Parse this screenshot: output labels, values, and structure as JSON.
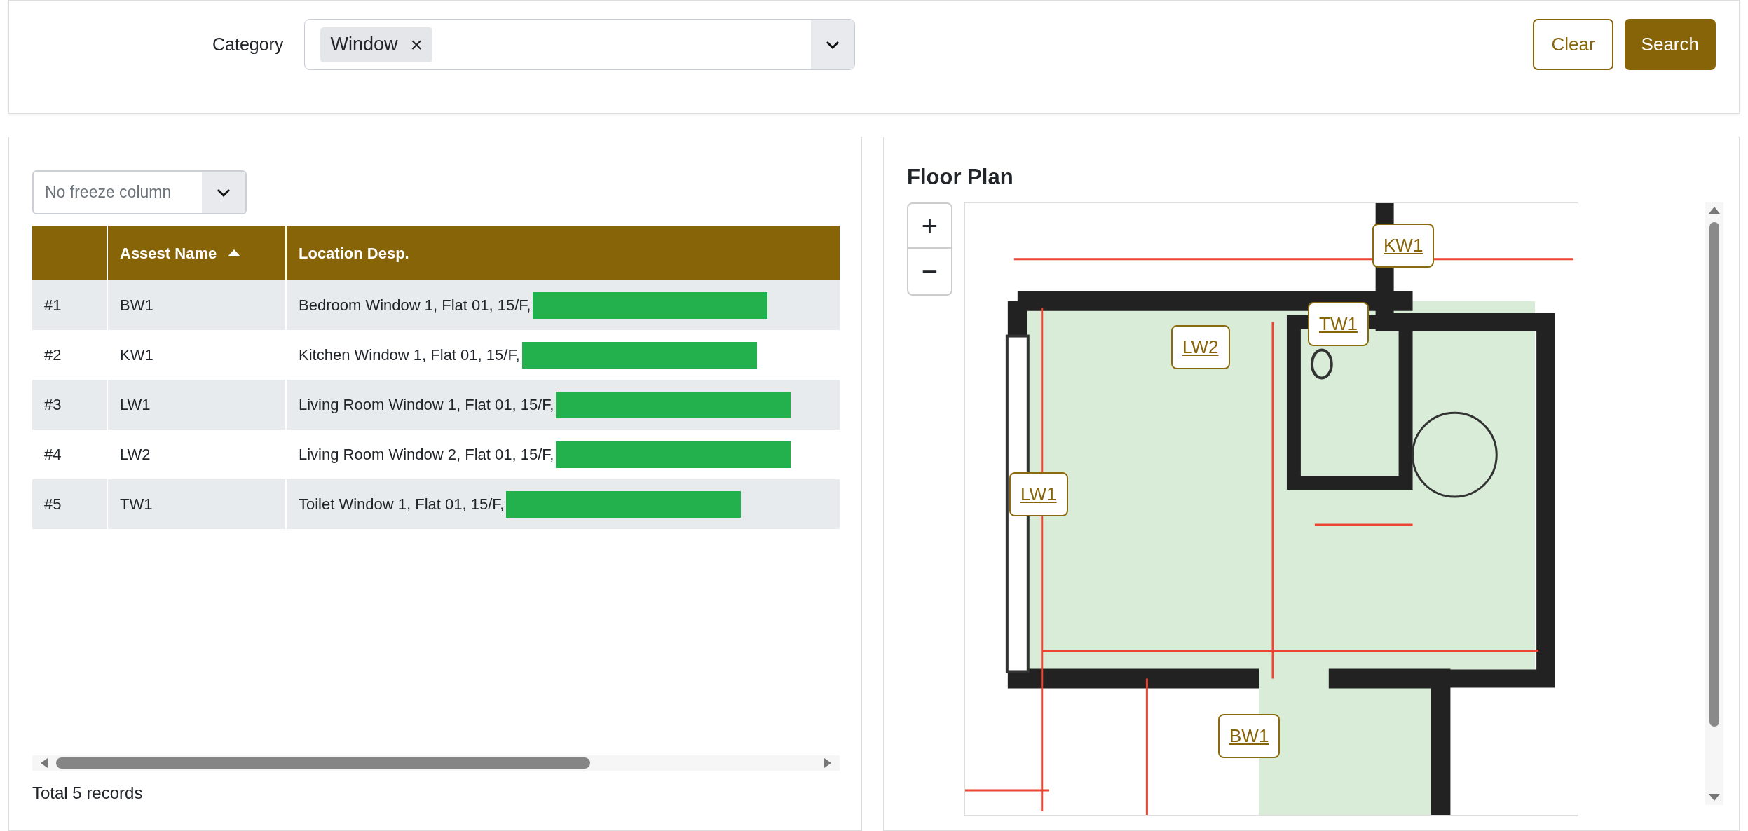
{
  "filter": {
    "label": "Category",
    "tags": [
      {
        "label": "Window",
        "remove": "×"
      }
    ]
  },
  "buttons": [
    {
      "label": "Clear",
      "kind": "outline"
    },
    {
      "label": "Search",
      "kind": "primary"
    }
  ],
  "freeze_select": {
    "value": "No freeze column"
  },
  "table": {
    "columns": [
      {
        "sorted": false
      },
      {
        "label": "Assest Name",
        "sorted": true
      },
      {
        "label": "Location Desp.",
        "sorted": false
      }
    ],
    "rows": [
      [
        "#1",
        "BW1",
        "Bedroom Window 1, Flat 01, 15/F,"
      ],
      [
        "#2",
        "KW1",
        "Kitchen Window 1, Flat 01, 15/F,"
      ],
      [
        "#3",
        "LW1",
        "Living Room Window 1, Flat 01, 15/F,"
      ],
      [
        "#4",
        "LW2",
        "Living Room Window 2, Flat 01, 15/F,"
      ],
      [
        "#5",
        "TW1",
        "Toilet Window 1, Flat 01, 15/F,"
      ]
    ]
  },
  "total": "Total 5 records",
  "floor_plan": {
    "title": "Floor Plan",
    "zoom_in": "+",
    "zoom_out": "−",
    "markers": [
      {
        "label": "KW1"
      },
      {
        "label": "TW1"
      },
      {
        "label": "LW2"
      },
      {
        "label": "LW1"
      },
      {
        "label": "BW1"
      }
    ]
  }
}
